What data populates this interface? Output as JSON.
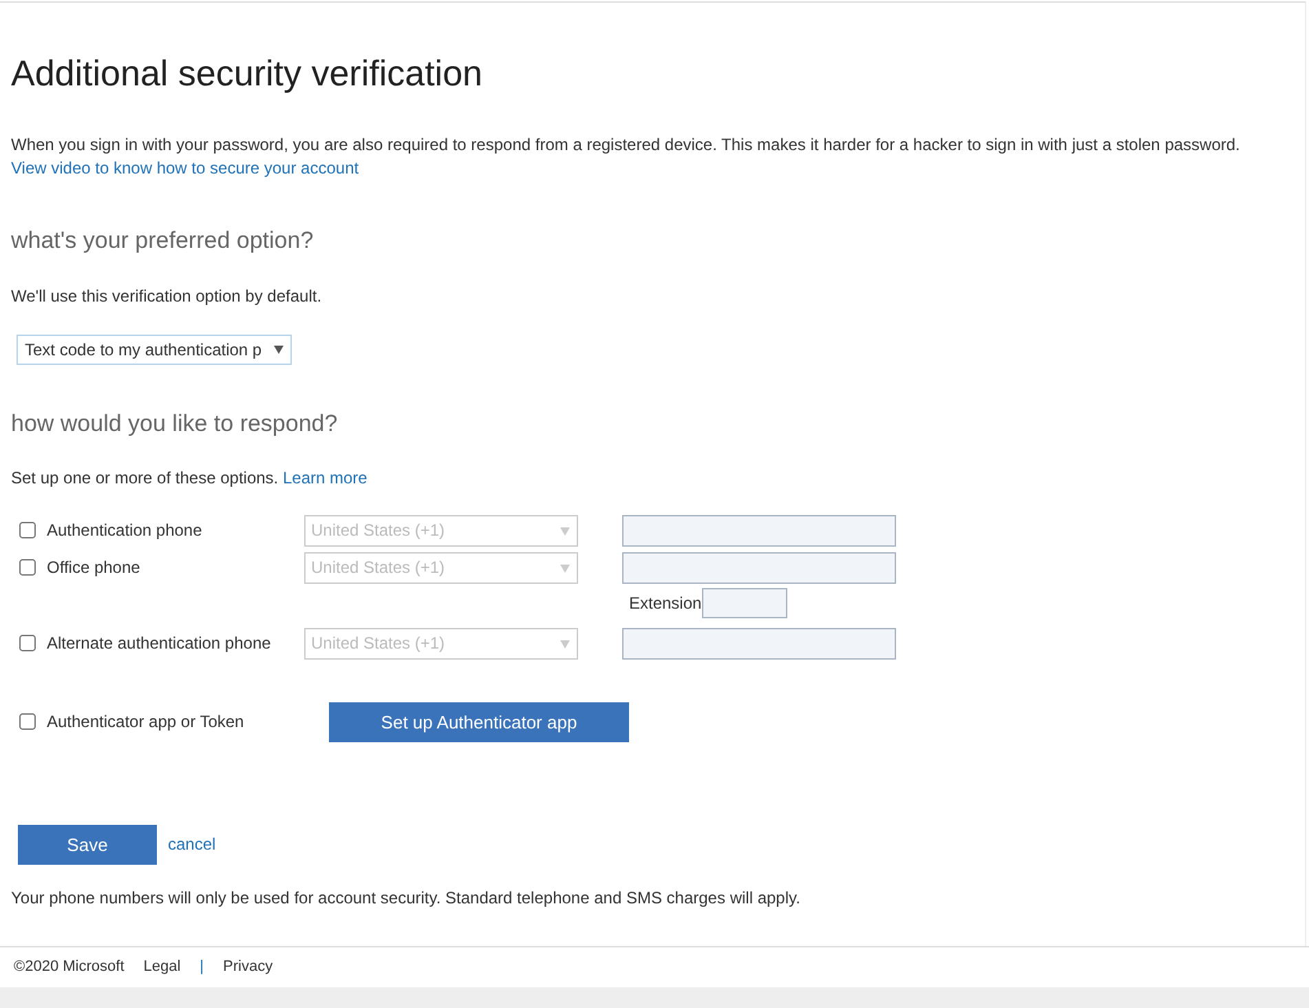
{
  "page": {
    "title": "Additional security verification",
    "intro": "When you sign in with your password, you are also required to respond from a registered device. This makes it harder for a hacker to sign in with just a stolen password.",
    "video_link": "View video to know how to secure your account"
  },
  "preferred": {
    "heading": "what's your preferred option?",
    "note": "We'll use this verification option by default.",
    "select_value": "Text code to my authentication p"
  },
  "respond": {
    "heading": "how would you like to respond?",
    "note": "Set up one or more of these options.",
    "learn_link": "Learn more",
    "methods": [
      {
        "kind": "phone",
        "label": "Authentication phone",
        "checked": false,
        "country": "United States (+1)",
        "disabled": true
      },
      {
        "kind": "phone",
        "label": "Office phone",
        "checked": false,
        "country": "United States (+1)",
        "disabled": true,
        "extension_label": "Extension"
      },
      {
        "kind": "phone",
        "label": "Alternate authentication phone",
        "checked": false,
        "country": "United States (+1)",
        "disabled": true
      },
      {
        "kind": "app",
        "label": "Authenticator app or Token",
        "checked": false,
        "button": "Set up Authenticator app"
      }
    ]
  },
  "actions": {
    "save": "Save",
    "cancel": "cancel"
  },
  "disclaimer": "Your phone numbers will only be used for account security. Standard telephone and SMS charges will apply.",
  "footer": {
    "copyright": "©2020 Microsoft",
    "links": [
      "Legal",
      "Privacy"
    ],
    "separator": "|"
  }
}
